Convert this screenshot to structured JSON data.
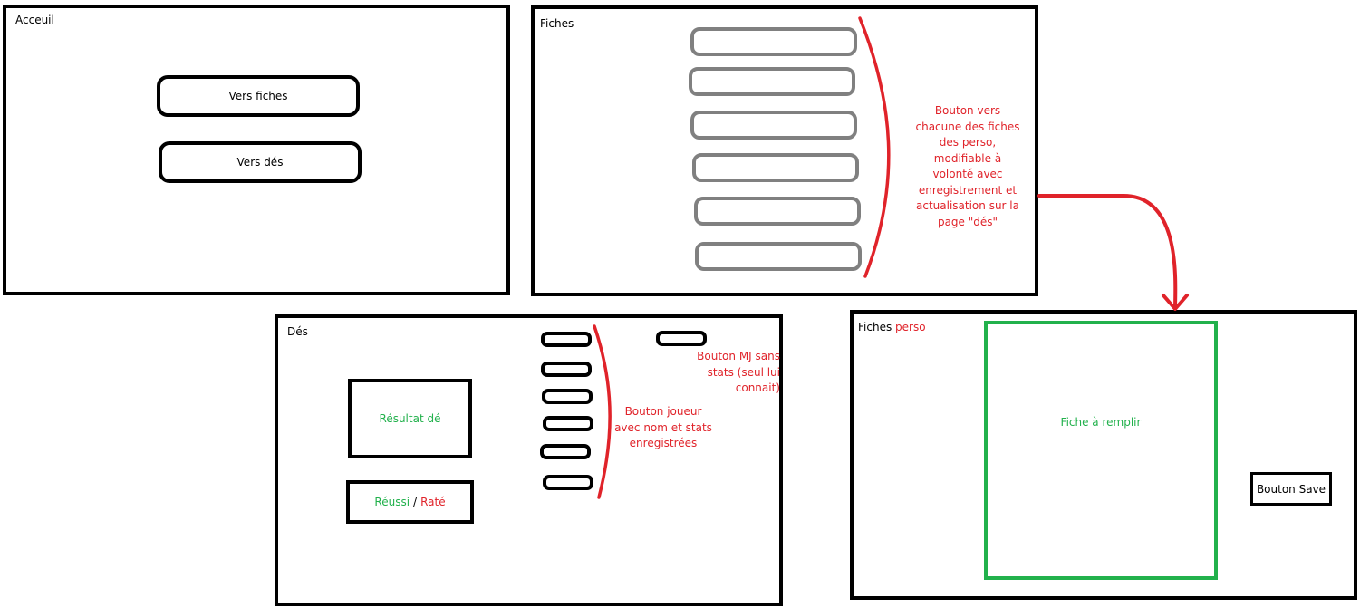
{
  "accueil": {
    "title": "Acceuil",
    "button_fiches": "Vers fiches",
    "button_des": "Vers dés"
  },
  "fiches": {
    "title": "Fiches",
    "note": "Bouton vers chacune des fiches des perso, modifiable à volonté avec enregistrement et actualisation sur la page \"dés\""
  },
  "des": {
    "title": "Dés",
    "result_label": "Résultat dé",
    "success_label": "Réussi",
    "separator": "/",
    "fail_label": "Raté",
    "player_note": "Bouton joueur avec nom et stats enregistrées",
    "mj_note": "Bouton MJ sans stats (seul lui connait)"
  },
  "fiches_perso": {
    "title_main": "Fiches",
    "title_accent": "perso",
    "sheet_label": "Fiche à remplir",
    "save_button": "Bouton Save"
  },
  "colors": {
    "red": "#e0232a",
    "green": "#22b14c",
    "gray": "#808080",
    "black": "#000000"
  }
}
